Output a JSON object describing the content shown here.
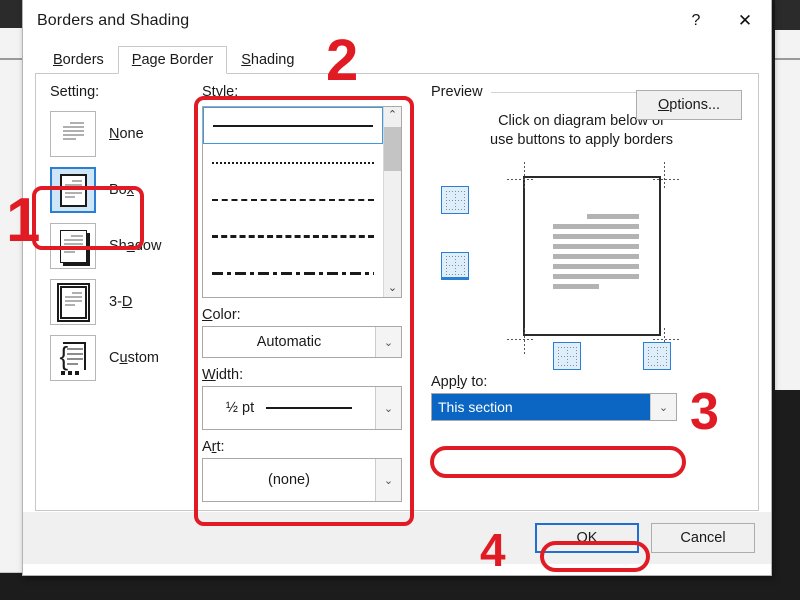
{
  "dialog": {
    "title": "Borders and Shading",
    "help_label": "?",
    "close_label": "✕"
  },
  "tabs": [
    {
      "label": "Borders",
      "accel": "B",
      "active": false
    },
    {
      "label": "Page Border",
      "accel": "P",
      "active": true
    },
    {
      "label": "Shading",
      "accel": "S",
      "active": false
    }
  ],
  "setting": {
    "label": "Setting:",
    "items": [
      {
        "label": "None",
        "icon": "page-no-border-icon",
        "selected": false
      },
      {
        "label": "Box",
        "icon": "page-box-border-icon",
        "selected": true
      },
      {
        "label": "Shadow",
        "icon": "page-shadow-border-icon",
        "selected": false
      },
      {
        "label": "3-D",
        "icon": "page-3d-border-icon",
        "selected": false
      },
      {
        "label": "Custom",
        "icon": "page-custom-border-icon",
        "selected": false
      }
    ]
  },
  "style": {
    "label": "Style:",
    "items": [
      {
        "name": "solid-line",
        "selected": true
      },
      {
        "name": "dotted-line",
        "selected": false
      },
      {
        "name": "dashed-line",
        "selected": false
      },
      {
        "name": "long-dashed-line",
        "selected": false
      },
      {
        "name": "dash-dot-line",
        "selected": false
      }
    ],
    "scroll_up": "⌃",
    "scroll_down": "⌄"
  },
  "color": {
    "label": "Color:",
    "value": "Automatic",
    "arrow": "⌄"
  },
  "width": {
    "label": "Width:",
    "value": "½ pt",
    "arrow": "⌄"
  },
  "art": {
    "label": "Art:",
    "value": "(none)",
    "arrow": "⌄"
  },
  "preview": {
    "label": "Preview",
    "hint_line1": "Click on diagram below or",
    "hint_line2": "use buttons to apply borders",
    "buttons": [
      {
        "name": "top-border-toggle"
      },
      {
        "name": "bottom-border-toggle"
      },
      {
        "name": "left-border-toggle"
      },
      {
        "name": "right-border-toggle"
      }
    ]
  },
  "apply_to": {
    "label": "Apply to:",
    "value": "This section",
    "arrow": "⌄"
  },
  "buttons": {
    "options": "Options...",
    "ok": "OK",
    "cancel": "Cancel"
  },
  "annotations": [
    {
      "number": "1",
      "target": "setting-box"
    },
    {
      "number": "2",
      "target": "style-group"
    },
    {
      "number": "3",
      "target": "apply-to"
    },
    {
      "number": "4",
      "target": "ok-button"
    }
  ],
  "colors": {
    "annotation_red": "#e01b24",
    "selection_blue": "#0a66c2",
    "accent_blue": "#2a7fd4"
  }
}
